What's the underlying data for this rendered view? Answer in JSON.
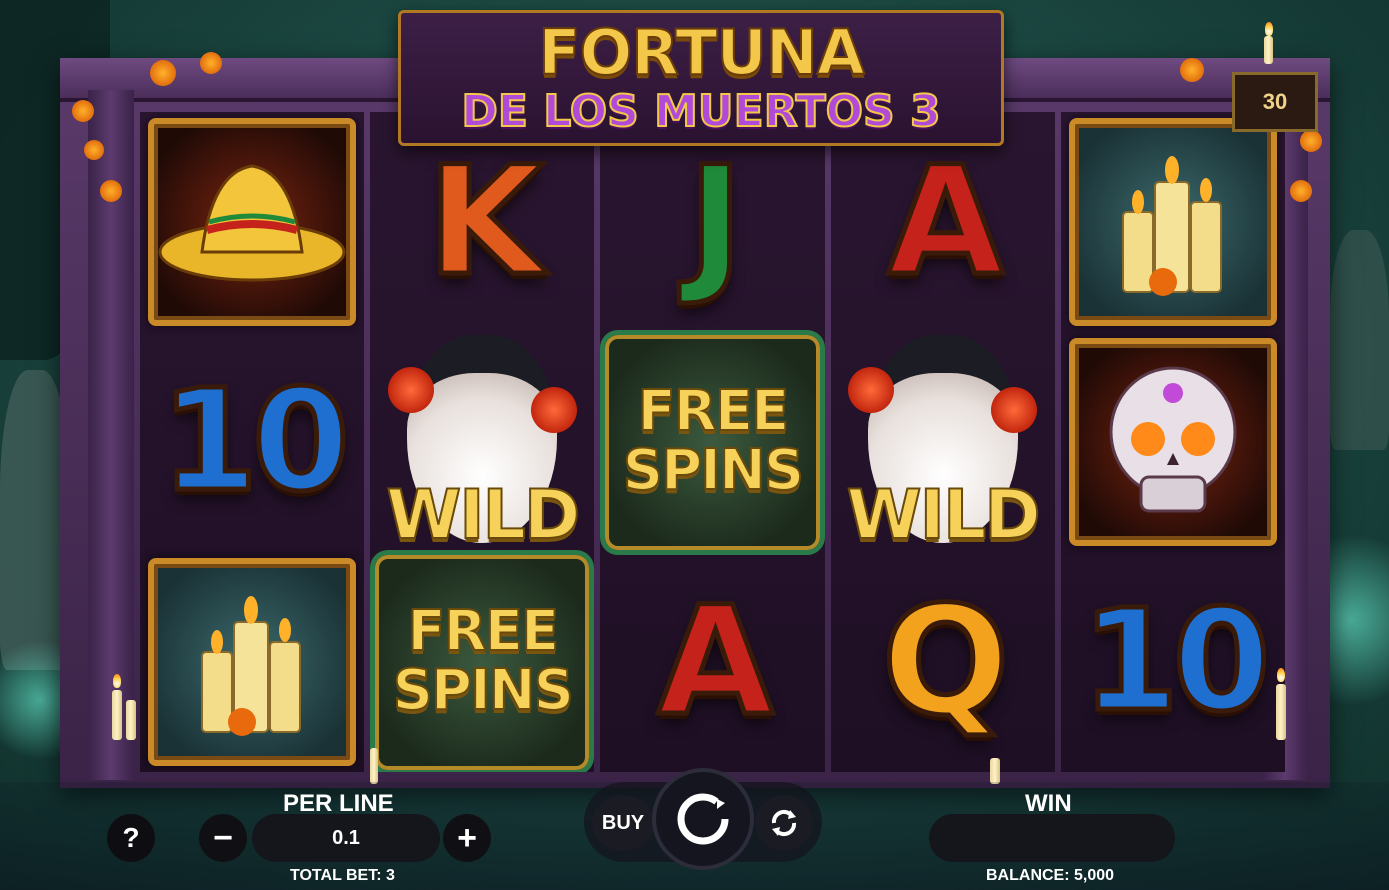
{
  "game": {
    "title_line1": "FORTUNA",
    "title_line2": "DE LOS MUERTOS 3",
    "lines": "30"
  },
  "reels": [
    [
      "sombrero",
      "10",
      "candles"
    ],
    [
      "K",
      "WILD",
      "FREE SPINS"
    ],
    [
      "J",
      "FREE SPINS",
      "A"
    ],
    [
      "A",
      "WILD",
      "Q"
    ],
    [
      "candles",
      "skull",
      "10"
    ]
  ],
  "symbol_text": {
    "free": "FREE",
    "spins": "SPINS",
    "wild": "WILD"
  },
  "controls": {
    "help": "?",
    "per_line_label": "PER LINE",
    "per_line_value": "0.1",
    "minus": "−",
    "plus": "+",
    "total_bet": "TOTAL BET: 3",
    "buy": "BUY",
    "win_label": "WIN",
    "win_value": "",
    "balance": "BALANCE: 5,000"
  },
  "colors": {
    "accent_gold": "#f3c74a",
    "title_purple": "#b04ad8"
  }
}
